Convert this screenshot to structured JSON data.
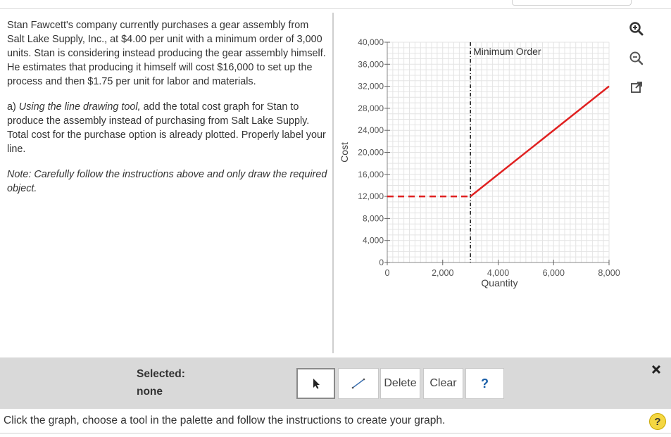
{
  "instructions": {
    "paragraph1": "Stan Fawcett's company currently purchases a gear assembly from Salt Lake Supply, Inc., at $4.00 per unit with a minimum order of 3,000 units. Stan is considering instead producing the gear assembly himself. He estimates that producing it himself will cost $16,000 to set up the process and then $1.75 per unit for labor and materials.",
    "part_a_label": "a) ",
    "part_a_italic": "Using the line drawing tool,",
    "part_a_text": " add the total cost graph for Stan to produce the assembly instead of purchasing from Salt Lake Supply.  Total cost for the purchase option is already plotted. Properly label your line.",
    "note": "Note: Carefully follow the instructions above and only draw the required object."
  },
  "chart_data": {
    "type": "line",
    "xlabel": "Quantity",
    "ylabel": "Cost",
    "xlim": [
      0,
      8000
    ],
    "ylim": [
      0,
      40000
    ],
    "x_ticks": [
      0,
      2000,
      4000,
      6000,
      8000
    ],
    "x_tick_labels": [
      "0",
      "2,000",
      "4,000",
      "6,000",
      "8,000"
    ],
    "y_ticks": [
      0,
      4000,
      8000,
      12000,
      16000,
      20000,
      24000,
      28000,
      32000,
      36000,
      40000
    ],
    "y_tick_labels": [
      "0",
      "4,000",
      "8,000",
      "12,000",
      "16,000",
      "20,000",
      "24,000",
      "28,000",
      "32,000",
      "36,000",
      "40,000"
    ],
    "grid": true,
    "series": [
      {
        "style": "dashed",
        "color": "#e02020",
        "x": [
          0,
          3000
        ],
        "y": [
          12000,
          12000
        ]
      },
      {
        "style": "solid",
        "color": "#e02020",
        "x": [
          3000,
          8000
        ],
        "y": [
          12000,
          32000
        ]
      }
    ],
    "annotations": [
      {
        "text": "Minimum Order",
        "x": 3000,
        "style": "dash-dot vertical line"
      }
    ]
  },
  "graph_controls": {
    "zoom_in_icon": "zoom-in-icon",
    "zoom_out_icon": "zoom-out-icon",
    "popout_icon": "popout-icon"
  },
  "toolbar": {
    "selected_label": "Selected:",
    "selected_value": "none",
    "pointer_icon": "pointer-icon",
    "line_tool_icon": "line-tool-icon",
    "delete_label": "Delete",
    "clear_label": "Clear",
    "help_label": "?"
  },
  "status": {
    "text": "Click the graph, choose a tool in the palette and follow the instructions to create your graph.",
    "help_label": "?"
  },
  "colors": {
    "accent": "#e02020",
    "toolbar_bg": "#d9d9d9",
    "help_blue": "#1a5fa8",
    "help_yellow": "#f5d742"
  }
}
